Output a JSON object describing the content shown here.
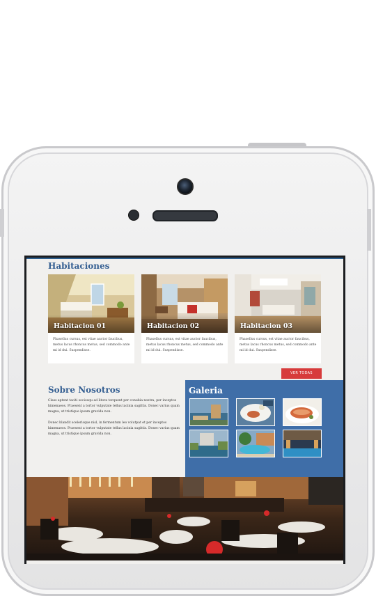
{
  "rooms": {
    "title": "Habitaciones",
    "items": [
      {
        "label": "Habitacion 01",
        "desc": "Phasellus cursus, est vitae auctor faucibus, metus lacus rhoncus metus, sed commodo ante mi id dui. Suspendisse."
      },
      {
        "label": "Habitacion 02",
        "desc": "Phasellus cursus, est vitae auctor faucibus, metus lacus rhoncus metus, sed commodo ante mi id dui. Suspendisse."
      },
      {
        "label": "Habitacion 03",
        "desc": "Phasellus cursus, est vitae auctor faucibus, metus lacus rhoncus metus, sed commodo ante mi id dui. Suspendisse."
      }
    ],
    "button_label": "VER TODAS"
  },
  "about": {
    "title": "Sobre Nosotros",
    "paragraph1": "Class aptent taciti sociosqu ad litora torquent per conubia nostra, per inceptos himenaeos. Praesent a tortor vulputate tellus lacinia sagittis. Donec varius quam magna, ut tristique ipsum gravida non.",
    "paragraph2": "Donec blandit scelerisque nisl, in fermentum leo volutpat et per inceptos himenaeos. Praesent a tortor vulputate tellus lacinia sagittis. Donec varius quam magna, ut tristique ipsum gravida non."
  },
  "gallery": {
    "title": "Galeria"
  },
  "colors": {
    "accent_blue": "#3f6ea8",
    "title_blue": "#355f92",
    "button_red": "#d73b3b"
  }
}
